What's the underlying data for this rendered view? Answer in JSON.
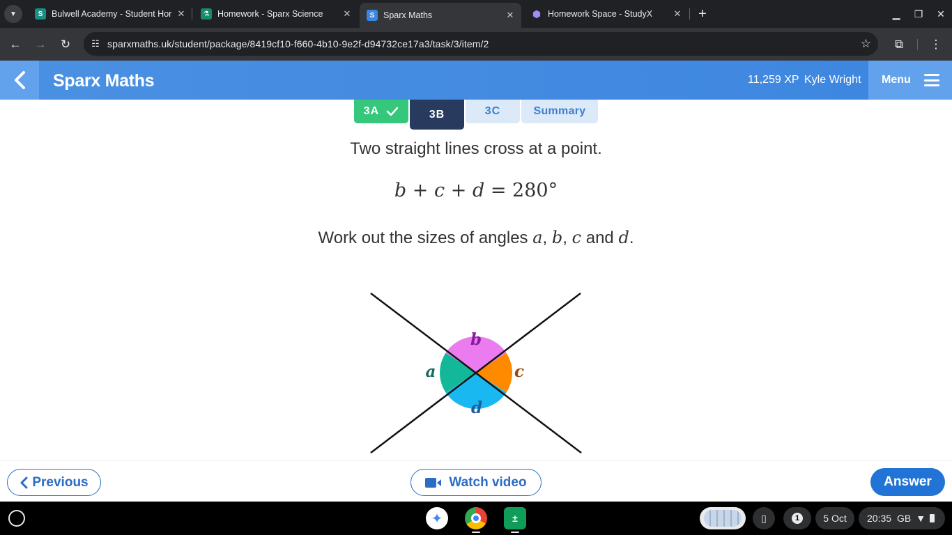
{
  "browser": {
    "tabs": [
      {
        "title": "Bulwell Academy - Student Hor",
        "favicon": "sparx-learning-icon"
      },
      {
        "title": "Homework - Sparx Science",
        "favicon": "flask-icon"
      },
      {
        "title": "Sparx Maths",
        "favicon": "sparx-s-icon"
      },
      {
        "title": "Homework Space - StudyX",
        "favicon": "studyx-cube-icon"
      }
    ],
    "url": "sparxmaths.uk/student/package/8419cf10-f660-4b10-9e2f-d94732ce17a3/task/3/item/2"
  },
  "header": {
    "brand": "Sparx Maths",
    "xp": "11,259 XP",
    "user": "Kyle Wright",
    "menu_label": "Menu"
  },
  "task_tabs": {
    "done": "3A",
    "current": "3B",
    "pending": "3C",
    "summary": "Summary"
  },
  "question": {
    "line1": "Two straight lines cross at a point.",
    "equation": {
      "b": "b",
      "c": "c",
      "d": "d",
      "equals": "280°"
    },
    "line2_prefix": "Work out the sizes of angles",
    "var_a": "a",
    "var_b": "b",
    "var_c": "c",
    "var_d": "d",
    "and": "and"
  },
  "diagram": {
    "labels": {
      "a": "a",
      "b": "b",
      "c": "c",
      "d": "d"
    },
    "colors": {
      "a": "#12b899",
      "b": "#ea7cf0",
      "c": "#ff8a00",
      "d": "#1ab8f0",
      "label_a": "#1a6b5c",
      "label_b": "#8a1b9e",
      "label_c": "#9a4a10",
      "label_d": "#1f5e9e"
    }
  },
  "footer": {
    "previous": "Previous",
    "watch_video": "Watch video",
    "answer": "Answer"
  },
  "shelf": {
    "notifications": "1",
    "date": "5 Oct",
    "time": "20:35",
    "locale": "GB"
  }
}
